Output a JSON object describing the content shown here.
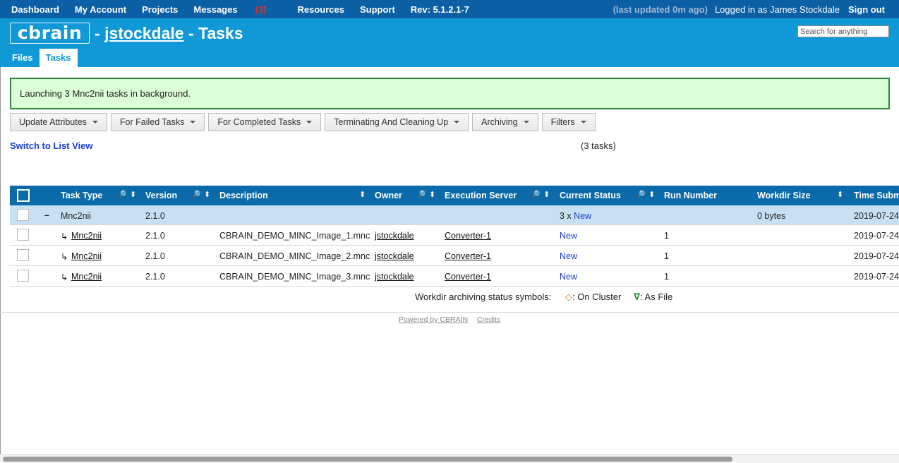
{
  "topnav": {
    "items": [
      "Dashboard",
      "My Account",
      "Projects",
      "Messages",
      "Resources",
      "Support"
    ],
    "messages_badge": "(3)",
    "revision": "Rev: 5.1.2.1-7",
    "last_updated": "(last updated 0m ago)",
    "logged_in": "Logged in as James Stockdale",
    "sign_out": "Sign out"
  },
  "header": {
    "logo": "cbrain",
    "title_sep1": "-",
    "user": "jstockdale",
    "title_rest": "- Tasks",
    "search_placeholder": "Search for anything",
    "tabs": [
      "Files",
      "Tasks"
    ]
  },
  "notice": "Launching 3 Mnc2nii tasks in background.",
  "buttons": [
    "Update Attributes",
    "For Failed Tasks",
    "For Completed Tasks",
    "Terminating And Cleaning Up",
    "Archiving",
    "Filters"
  ],
  "switch_view": "Switch to List View",
  "task_count": "(3 tasks)",
  "table": {
    "columns": [
      "Task Type",
      "Version",
      "Description",
      "Owner",
      "Execution Server",
      "Current Status",
      "Run Number",
      "Workdir Size",
      "Time Subm"
    ],
    "group": {
      "toggle": "–",
      "task_type": "Mnc2nii",
      "version": "2.1.0",
      "status_prefix": "3 x",
      "status": "New",
      "workdir_size": "0 bytes",
      "time": "2019-07-24"
    },
    "rows": [
      {
        "arrow": "↳",
        "task_type": "Mnc2nii",
        "version": "2.1.0",
        "description": "CBRAIN_DEMO_MINC_Image_1.mnc",
        "owner": "jstockdale",
        "server": "Converter-1",
        "status": "New",
        "run": "1",
        "time": "2019-07-24"
      },
      {
        "arrow": "↳",
        "task_type": "Mnc2nii",
        "version": "2.1.0",
        "description": "CBRAIN_DEMO_MINC_Image_2.mnc",
        "owner": "jstockdale",
        "server": "Converter-1",
        "status": "New",
        "run": "1",
        "time": "2019-07-24"
      },
      {
        "arrow": "↳",
        "task_type": "Mnc2nii",
        "version": "2.1.0",
        "description": "CBRAIN_DEMO_MINC_Image_3.mnc",
        "owner": "jstockdale",
        "server": "Converter-1",
        "status": "New",
        "run": "1",
        "time": "2019-07-24"
      }
    ]
  },
  "legend": {
    "label": "Workdir archiving status symbols:",
    "cluster_symbol": "◇",
    "cluster": ": On Cluster",
    "file_symbol": "∇",
    "file": ": As File"
  },
  "footer": {
    "powered": "Powered by CBRAIN",
    "credits": "Credits"
  },
  "icons": {
    "filter": "magnifier-icon",
    "sort": "sort-arrows-icon"
  }
}
